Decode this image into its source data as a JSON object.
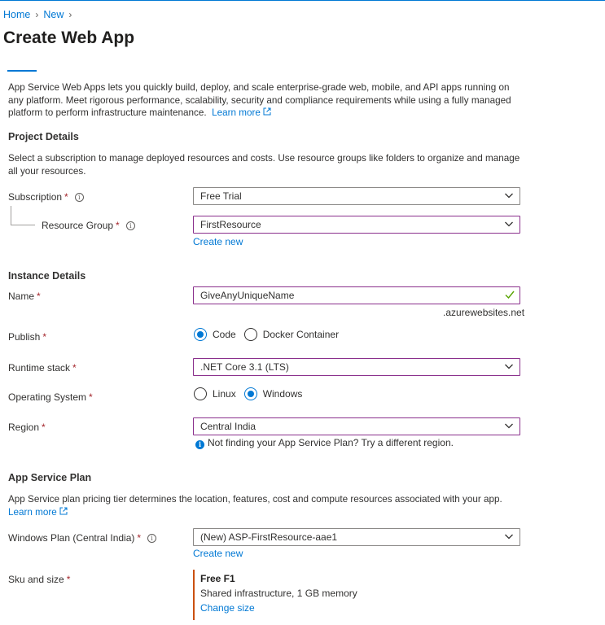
{
  "breadcrumb": {
    "home": "Home",
    "new": "New"
  },
  "page": {
    "title": "Create Web App"
  },
  "intro": {
    "text": "App Service Web Apps lets you quickly build, deploy, and scale enterprise-grade web, mobile, and API apps running on any platform. Meet rigorous performance, scalability, security and compliance requirements while using a fully managed platform to perform infrastructure maintenance.",
    "learn_more": "Learn more"
  },
  "project": {
    "heading": "Project Details",
    "description": "Select a subscription to manage deployed resources and costs. Use resource groups like folders to organize and manage all your resources.",
    "subscription_label": "Subscription",
    "subscription_value": "Free Trial",
    "resource_group_label": "Resource Group",
    "resource_group_value": "FirstResource",
    "create_new": "Create new"
  },
  "instance": {
    "heading": "Instance Details",
    "name_label": "Name",
    "name_value": "GiveAnyUniqueName",
    "name_suffix": ".azurewebsites.net",
    "publish_label": "Publish",
    "publish_options": [
      "Code",
      "Docker Container"
    ],
    "publish_selected": "Code",
    "runtime_label": "Runtime stack",
    "runtime_value": ".NET Core 3.1 (LTS)",
    "os_label": "Operating System",
    "os_options": [
      "Linux",
      "Windows"
    ],
    "os_selected": "Windows",
    "region_label": "Region",
    "region_value": "Central India",
    "region_hint": "Not finding your App Service Plan? Try a different region."
  },
  "plan": {
    "heading": "App Service Plan",
    "description": "App Service plan pricing tier determines the location, features, cost and compute resources associated with your app.",
    "learn_more": "Learn more",
    "windows_plan_label": "Windows Plan (Central India)",
    "windows_plan_value": "(New) ASP-FirstResource-aae1",
    "create_new": "Create new",
    "sku_label": "Sku and size",
    "sku_name": "Free F1",
    "sku_detail": "Shared infrastructure, 1 GB memory",
    "change_size": "Change size"
  },
  "required_mark": "*",
  "info_glyph": "i",
  "external_link_icon": "external-link-icon",
  "colors": {
    "accent": "#0078d4",
    "required": "#a4262c",
    "focus_border": "#8a2f8c",
    "valid": "#57a300",
    "sku_bar": "#ca5010"
  }
}
